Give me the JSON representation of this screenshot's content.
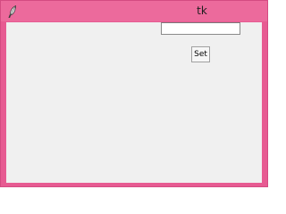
{
  "window": {
    "title": "tk",
    "icon": "feather-icon",
    "titlebar_color": "#ec6a9c",
    "frame_color": "#e75b92",
    "client_color": "#f0f0f0"
  },
  "entry": {
    "value": "",
    "placeholder": ""
  },
  "set_button": {
    "label": "Set"
  }
}
